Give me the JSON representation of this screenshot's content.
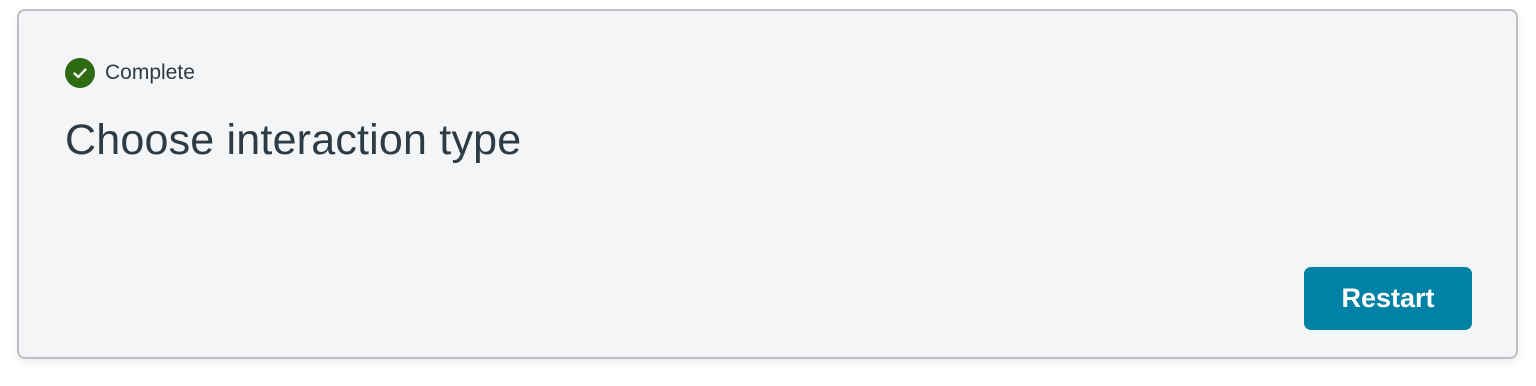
{
  "status": {
    "icon": "check-circle-icon",
    "label": "Complete",
    "color": "#2f6b12"
  },
  "title": "Choose interaction type",
  "actions": {
    "restart_label": "Restart",
    "accent": "#0181a6"
  }
}
